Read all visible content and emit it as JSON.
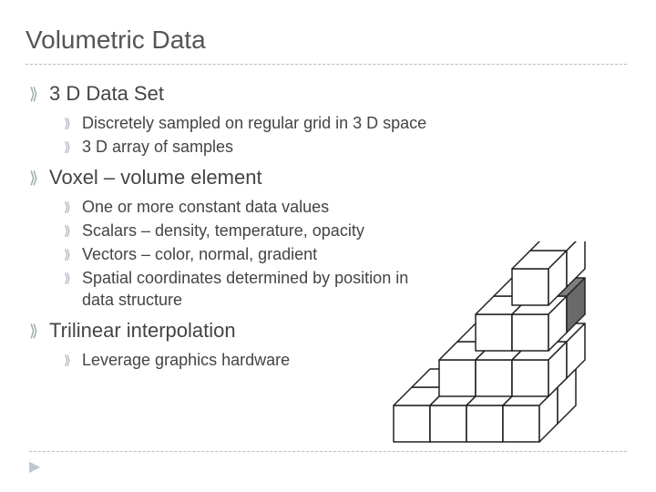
{
  "title": "Volumetric Data",
  "bullets": [
    {
      "text": "3 D Data Set",
      "sub": [
        "Discretely sampled on regular grid in 3 D space",
        "3 D array of samples"
      ]
    },
    {
      "text": "Voxel – volume element",
      "sub": [
        "One or more constant data values",
        "Scalars – density, temperature, opacity",
        "Vectors – color, normal, gradient",
        "Spatial coordinates determined by position in data structure"
      ]
    },
    {
      "text": "Trilinear interpolation",
      "sub": [
        "Leverage graphics hardware"
      ]
    }
  ],
  "icons": {
    "level1": "⟫",
    "level2": "⟫",
    "footer": "▶"
  }
}
